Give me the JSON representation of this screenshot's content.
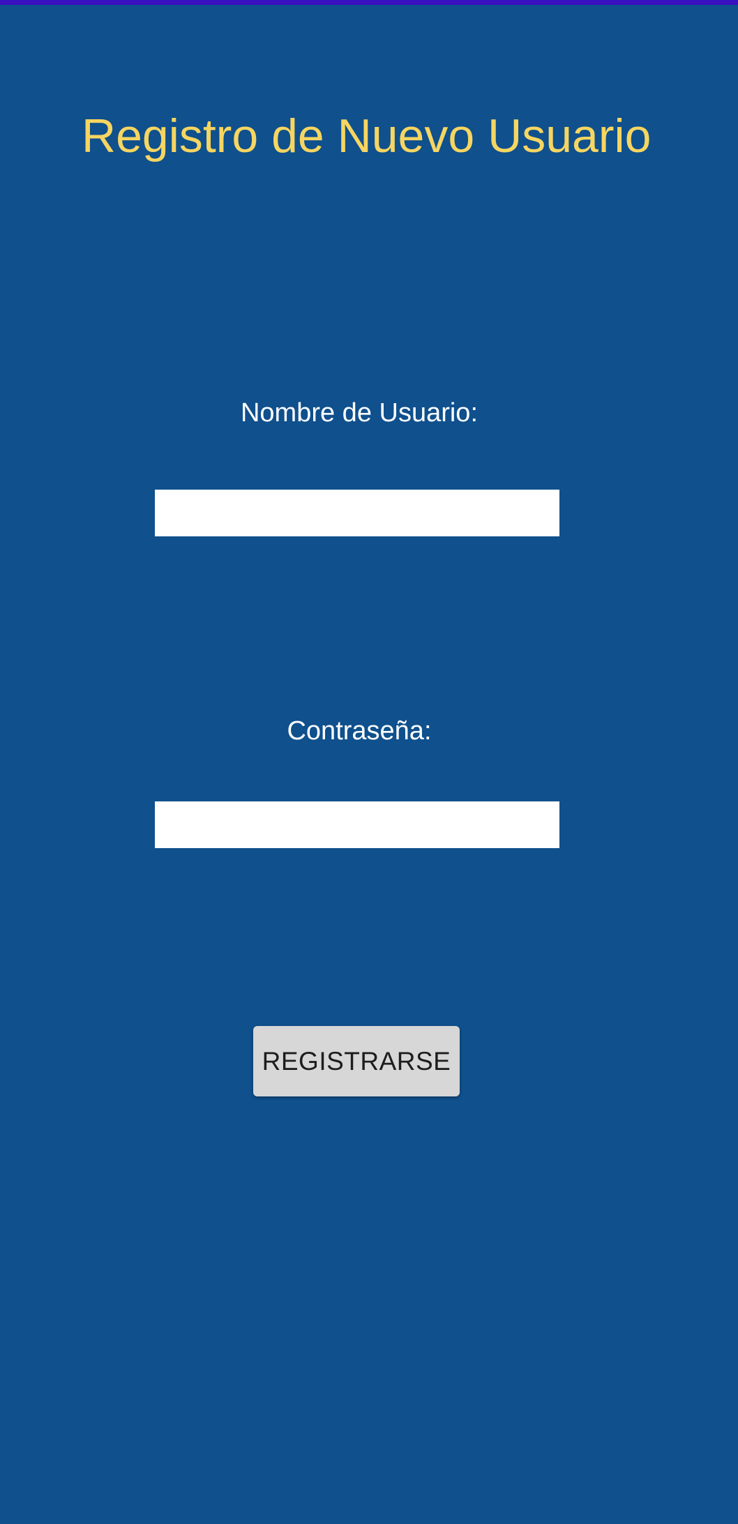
{
  "colors": {
    "background": "#0f508d",
    "status_strip": "#3a10c0",
    "title": "#f6d561",
    "label": "#ffffff",
    "input_background": "#ffffff",
    "button_background": "#d6d7d6",
    "button_text": "#1d1d1d"
  },
  "form": {
    "title": "Registro de Nuevo Usuario",
    "username_label": "Nombre de Usuario:",
    "username_value": "",
    "password_label": "Contraseña:",
    "password_value": "",
    "submit_label": "REGISTRARSE"
  }
}
